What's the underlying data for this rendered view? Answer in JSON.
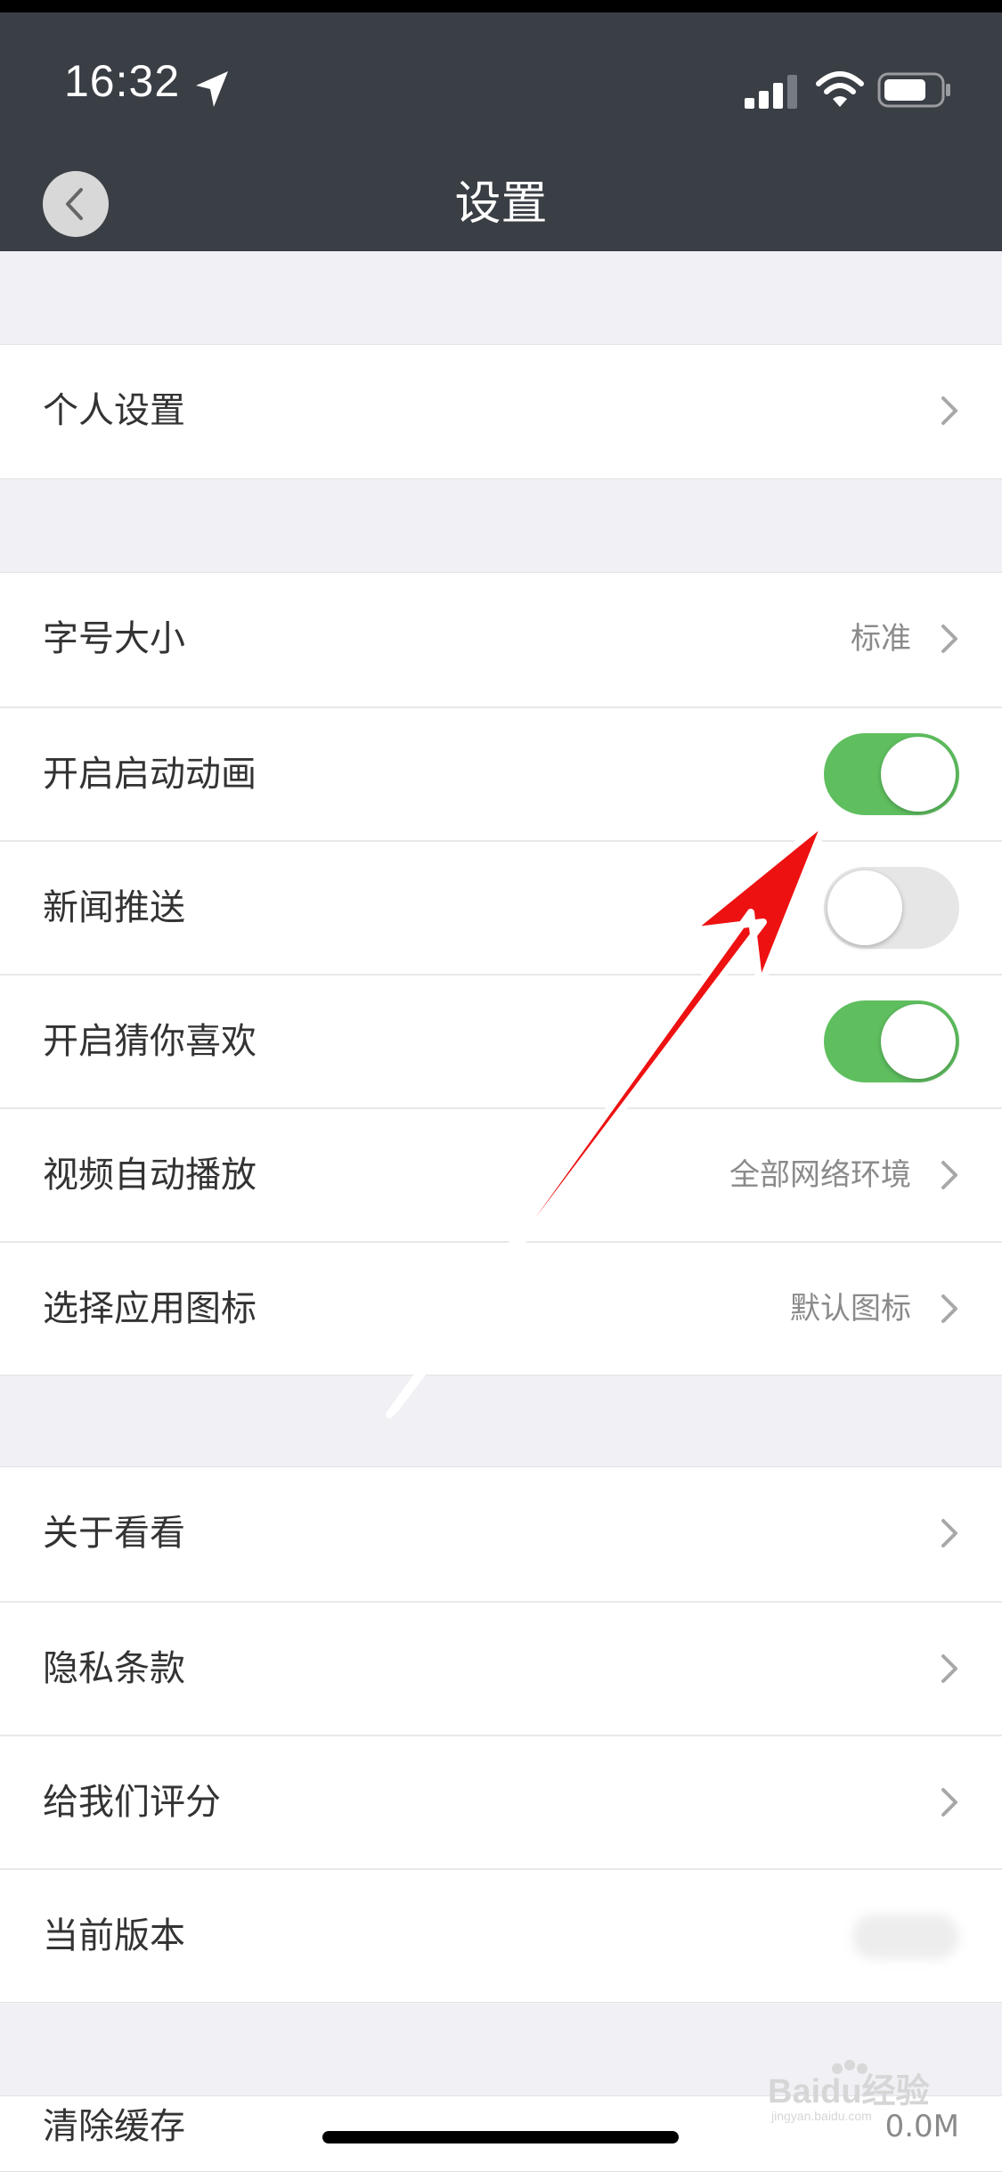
{
  "status_bar": {
    "time": "16:32"
  },
  "nav": {
    "title": "设置"
  },
  "group1": [
    {
      "label": "个人设置"
    }
  ],
  "group2": [
    {
      "label": "字号大小",
      "value": "标准"
    },
    {
      "label": "开启启动动画",
      "toggle": "on"
    },
    {
      "label": "新闻推送",
      "toggle": "off"
    },
    {
      "label": "开启猜你喜欢",
      "toggle": "on"
    },
    {
      "label": "视频自动播放",
      "value": "全部网络环境"
    },
    {
      "label": "选择应用图标",
      "value": "默认图标"
    }
  ],
  "group3": [
    {
      "label": "关于看看"
    },
    {
      "label": "隐私条款"
    },
    {
      "label": "给我们评分"
    },
    {
      "label": "当前版本"
    }
  ],
  "group4": [
    {
      "label": "清除缓存",
      "value": "0.0M"
    }
  ],
  "watermark": {
    "text": "Baidu经验",
    "subtext": "jingyan.baidu.com"
  },
  "colors": {
    "nav_bg": "#3a3e45",
    "toggle_on": "#5fbf5f",
    "annotation_arrow": "#ee1111"
  },
  "icons": {
    "location": "location-arrow-icon",
    "signal": "cellular-signal-icon",
    "wifi": "wifi-icon",
    "battery": "battery-icon",
    "back": "chevron-left-icon",
    "row": "chevron-right-icon"
  }
}
